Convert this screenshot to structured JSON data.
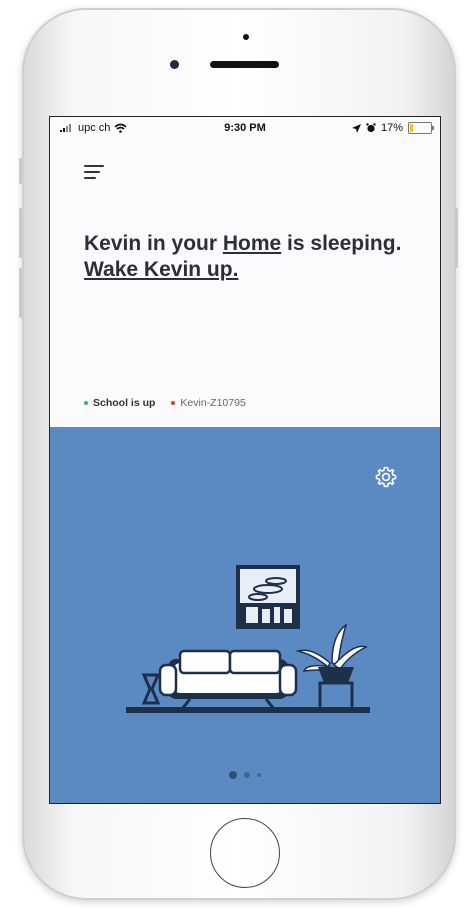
{
  "status_bar": {
    "carrier": "upc ch",
    "time": "9:30 PM",
    "battery_percent": "17%",
    "battery_level": 0.17
  },
  "main": {
    "headline_part1": "Kevin in your ",
    "headline_link_home": "Home",
    "headline_part2": " is sleeping.",
    "headline_action": "Wake Kevin up."
  },
  "tags": [
    {
      "label": "School is up",
      "color": "#3bb273"
    },
    {
      "label": "Kevin-Z10795",
      "color": "#e23b3b"
    }
  ],
  "pager": {
    "count": 3,
    "active_index": 0
  },
  "colors": {
    "room_background": "#5b8ac3",
    "illustration_dark": "#1e2f4a",
    "headline": "#2b2f38"
  },
  "icons": [
    "menu-icon",
    "settings-gear-icon",
    "wifi-icon",
    "signal-icon",
    "location-arrow-icon",
    "alarm-icon",
    "battery-icon"
  ]
}
